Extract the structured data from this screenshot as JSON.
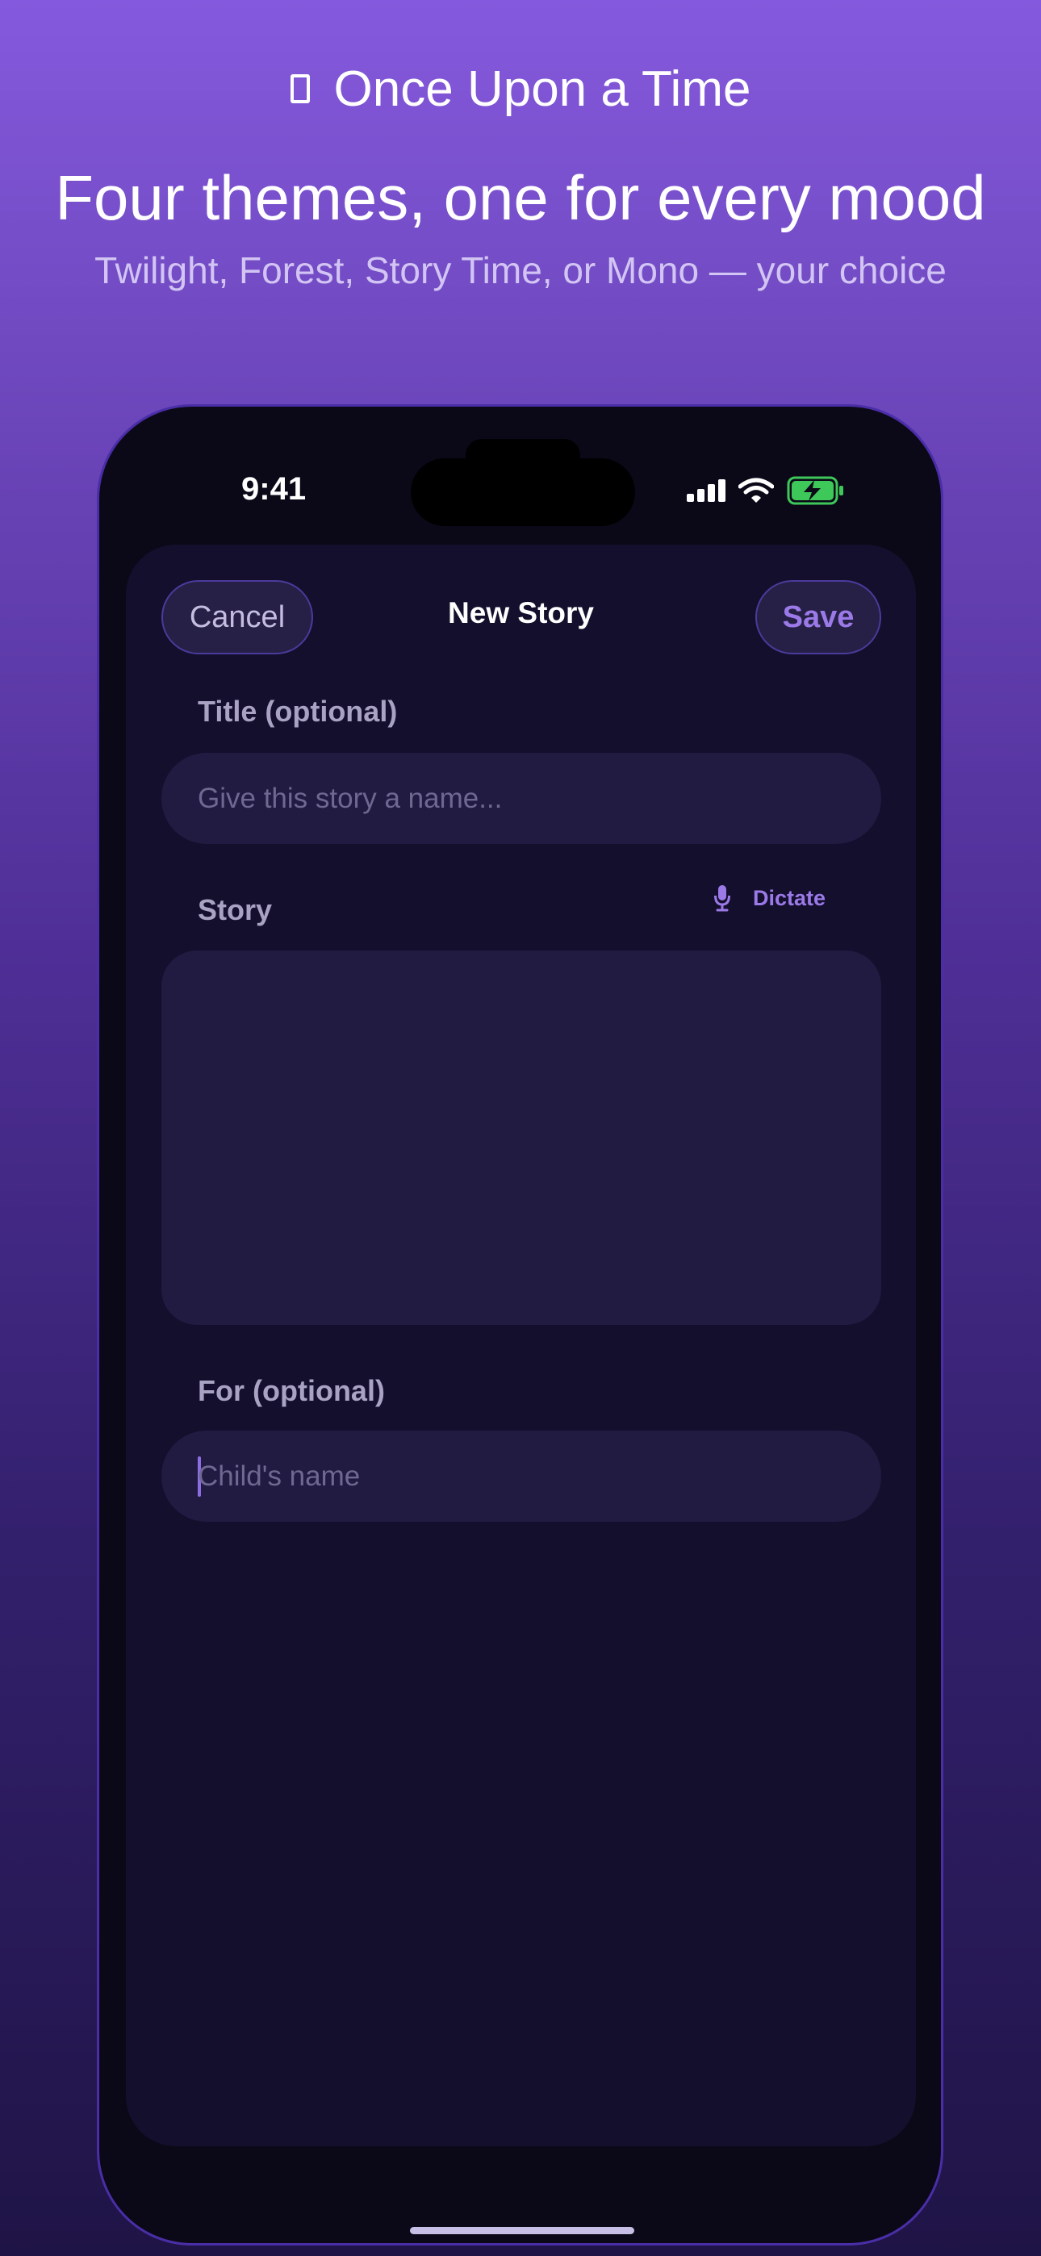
{
  "header": {
    "brand_icon": "book-icon",
    "brand_title": "Once Upon a Time",
    "headline": "Four themes, one for every mood",
    "subline": "Twilight, Forest, Story Time, or Mono — your choice"
  },
  "status_bar": {
    "time": "9:41",
    "icons": [
      "cellular-signal-icon",
      "wifi-icon",
      "battery-charging-icon"
    ],
    "battery_color": "#3ec85a"
  },
  "sheet": {
    "cancel_label": "Cancel",
    "title": "New Story",
    "save_label": "Save",
    "title_field": {
      "label": "Title (optional)",
      "placeholder": "Give this story a name..."
    },
    "story_field": {
      "label": "Story",
      "dictate_label": "Dictate",
      "value": ""
    },
    "for_field": {
      "label": "For (optional)",
      "placeholder": "Child's name"
    }
  },
  "colors": {
    "accent": "#9b7ae8",
    "sheet_background": "#130f2d",
    "field_background": "#211b42"
  }
}
